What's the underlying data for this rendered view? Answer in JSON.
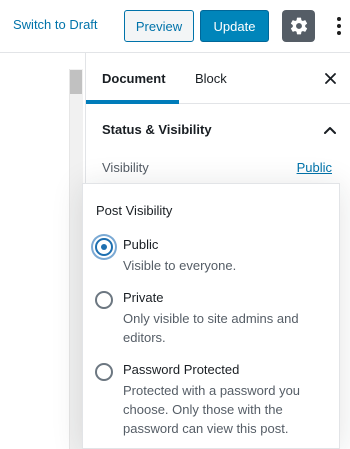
{
  "toolbar": {
    "switch_to_draft": "Switch to Draft",
    "preview": "Preview",
    "update": "Update",
    "settings_icon": "gear-icon",
    "more_icon": "more-vertical-icon"
  },
  "sidebar": {
    "tabs": [
      {
        "label": "Document",
        "active": true
      },
      {
        "label": "Block",
        "active": false
      }
    ],
    "close_icon": "close-icon",
    "section": {
      "title": "Status & Visibility",
      "toggle_icon": "chevron-up-icon",
      "visibility_label": "Visibility",
      "visibility_value": "Public"
    }
  },
  "popover": {
    "title": "Post Visibility",
    "options": [
      {
        "label": "Public",
        "description": "Visible to everyone.",
        "checked": true
      },
      {
        "label": "Private",
        "description": "Only visible to site admins and editors.",
        "checked": false
      },
      {
        "label": "Password Protected",
        "description": "Protected with a password you choose. Only those with the password can view this post.",
        "checked": false
      }
    ]
  },
  "colors": {
    "accent": "#0085ba",
    "link": "#0073aa",
    "gear_bg": "#555d66"
  }
}
